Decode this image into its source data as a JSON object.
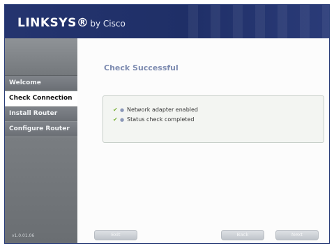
{
  "header": {
    "brand": "LINKSYS®",
    "brand_sub": "by Cisco"
  },
  "sidebar": {
    "items": [
      {
        "label": "Welcome",
        "active": false
      },
      {
        "label": "Check Connection",
        "active": true
      },
      {
        "label": "Install Router",
        "active": false
      },
      {
        "label": "Configure Router",
        "active": false
      }
    ],
    "version": "v1.0.01.06"
  },
  "content": {
    "title": "Check Successful",
    "status": [
      {
        "icon": "checkmark-icon",
        "text": "Network adapter enabled"
      },
      {
        "icon": "checkmark-icon",
        "text": "Status check completed"
      }
    ]
  },
  "buttons": {
    "left": "Exit",
    "middle": "Back",
    "right": "Next"
  },
  "colors": {
    "header": "#24346f",
    "sidebar": "#7a7e82",
    "title": "#7d8bb0",
    "check": "#7bb339"
  }
}
